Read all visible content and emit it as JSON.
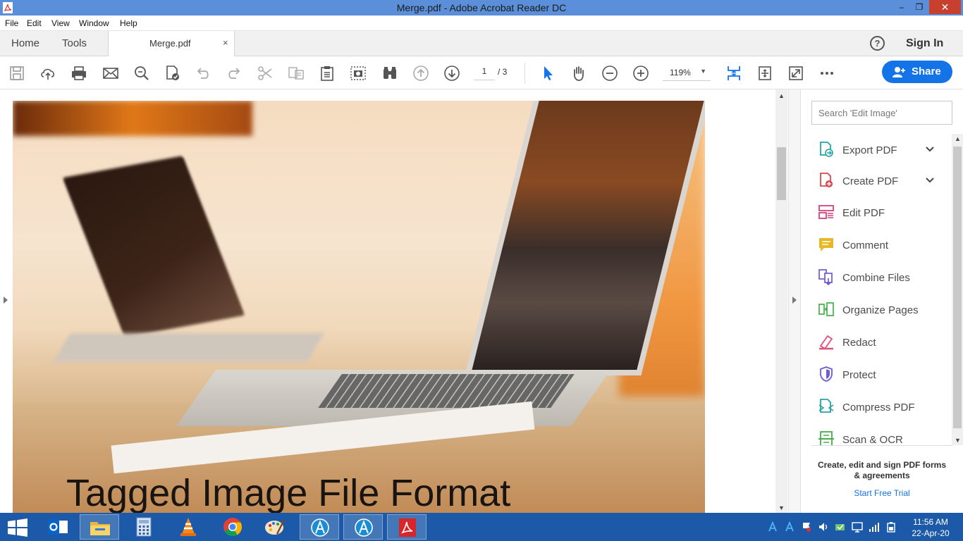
{
  "window": {
    "title": "Merge.pdf - Adobe Acrobat Reader DC",
    "minimize": "–",
    "restore": "❐",
    "close": "✕"
  },
  "menu": [
    "File",
    "Edit",
    "View",
    "Window",
    "Help"
  ],
  "tabs": {
    "home": "Home",
    "tools": "Tools",
    "document": "Merge.pdf",
    "close": "×",
    "help": "?",
    "sign_in": "Sign In"
  },
  "toolbar": {
    "page_current": "1",
    "page_total": "/ 3",
    "zoom": "119%",
    "share_label": "Share",
    "icons": [
      "save-icon",
      "upload-icon",
      "print-icon",
      "email-icon",
      "search-icon",
      "certify-icon",
      "undo-icon",
      "redo-icon",
      "cut-icon",
      "copy-icon",
      "clipboard-icon",
      "snapshot-icon",
      "find-icon",
      "page-up-icon",
      "page-down-icon",
      "select-cursor-icon",
      "hand-icon",
      "zoom-out-icon",
      "zoom-in-icon",
      "fit-page-icon",
      "rotate-icon",
      "full-screen-icon",
      "more-icon"
    ]
  },
  "document": {
    "visible_text": "Tagged Image File Format"
  },
  "right_pane": {
    "search_placeholder": "Search 'Edit Image'",
    "tools": [
      {
        "label": "Export PDF",
        "icon": "export-pdf-icon",
        "color": "#26a4a4",
        "expandable": true
      },
      {
        "label": "Create PDF",
        "icon": "create-pdf-icon",
        "color": "#e0454b",
        "expandable": true
      },
      {
        "label": "Edit PDF",
        "icon": "edit-pdf-icon",
        "color": "#d4427d",
        "expandable": false
      },
      {
        "label": "Comment",
        "icon": "comment-icon",
        "color": "#e7b825",
        "expandable": false
      },
      {
        "label": "Combine Files",
        "icon": "combine-files-icon",
        "color": "#6c5bd4",
        "expandable": false
      },
      {
        "label": "Organize Pages",
        "icon": "organize-pages-icon",
        "color": "#43b048",
        "expandable": false
      },
      {
        "label": "Redact",
        "icon": "redact-icon",
        "color": "#e0507a",
        "expandable": false
      },
      {
        "label": "Protect",
        "icon": "protect-icon",
        "color": "#6b5bd4",
        "expandable": false
      },
      {
        "label": "Compress PDF",
        "icon": "compress-pdf-icon",
        "color": "#26a4a4",
        "expandable": false
      },
      {
        "label": "Scan & OCR",
        "icon": "scan-ocr-icon",
        "color": "#43b048",
        "expandable": false
      }
    ],
    "promo_text": "Create, edit and sign PDF forms & agreements",
    "trial_link": "Start Free Trial"
  },
  "taskbar": {
    "apps": [
      "outlook-icon",
      "file-explorer-icon",
      "calculator-icon",
      "vlc-icon",
      "chrome-icon",
      "paint-icon",
      "app-a-icon",
      "app-a2-icon",
      "acrobat-icon"
    ],
    "time": "11:56 AM",
    "date": "22-Apr-20"
  },
  "colors": {
    "titlebar": "#5b8fd9",
    "accent": "#1473e6",
    "taskbar": "#1c59a8"
  }
}
